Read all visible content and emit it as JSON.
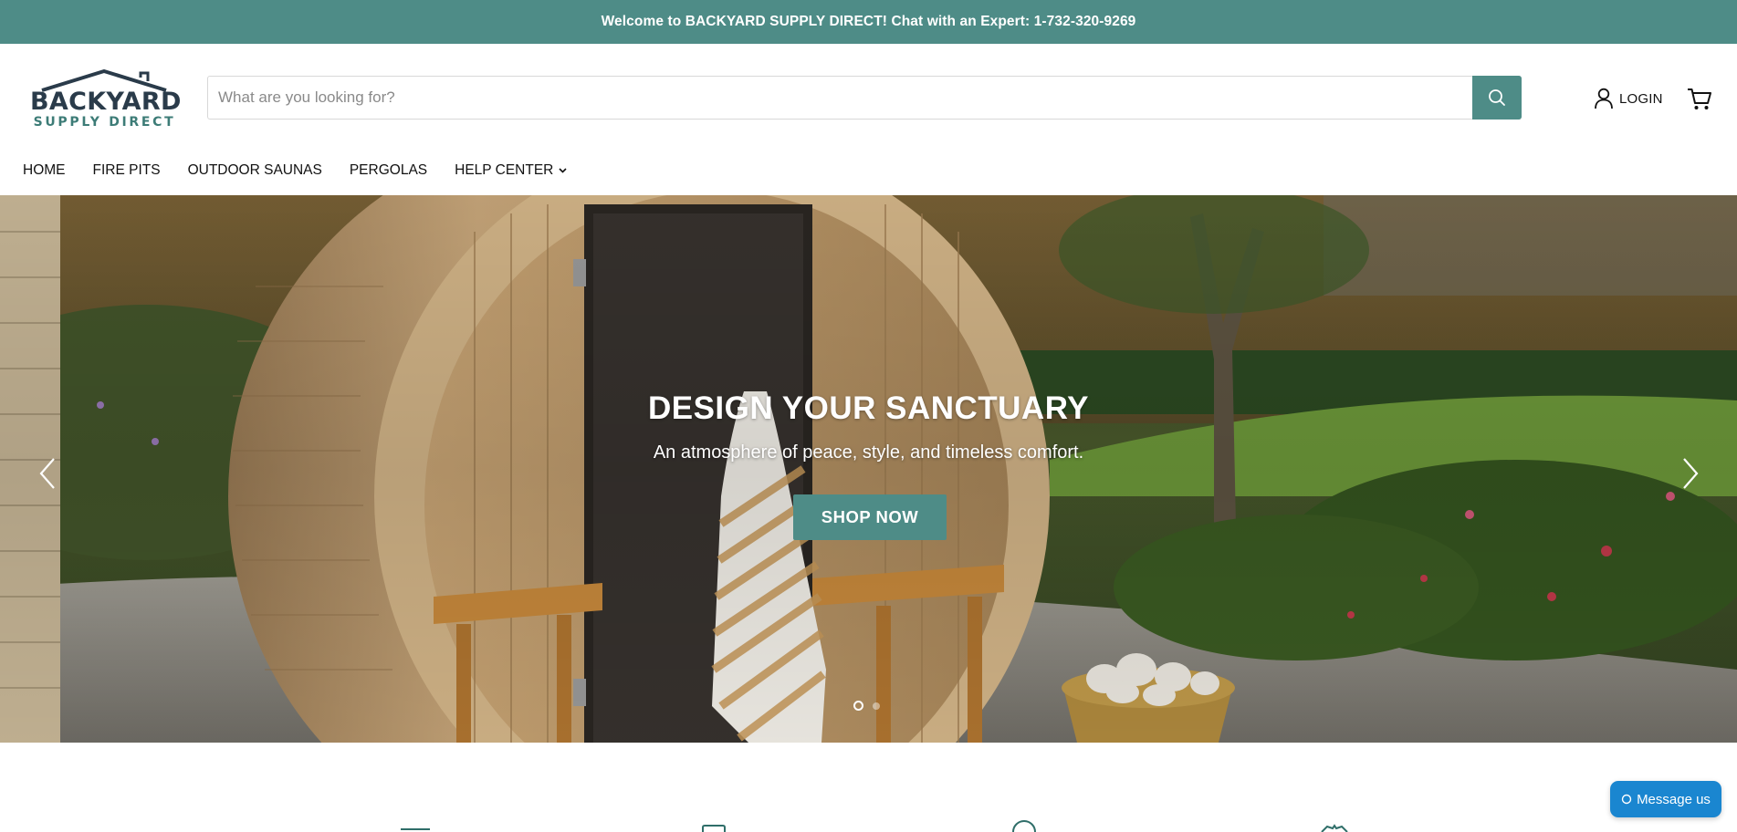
{
  "announcement": {
    "text": "Welcome to BACKYARD SUPPLY DIRECT! Chat with an Expert: 1-732-320-9269"
  },
  "brand": {
    "name": "BACKYARD",
    "tagline": "SUPPLY DIRECT"
  },
  "search": {
    "placeholder": "What are you looking for?",
    "value": "",
    "button_icon": "search-icon"
  },
  "account": {
    "login_label": "LOGIN",
    "login_icon": "user-icon",
    "cart_icon": "cart-icon"
  },
  "nav": {
    "items": [
      {
        "label": "HOME"
      },
      {
        "label": "FIRE PITS"
      },
      {
        "label": "OUTDOOR SAUNAS"
      },
      {
        "label": "PERGOLAS"
      },
      {
        "label": "HELP CENTER",
        "has_dropdown": true
      }
    ]
  },
  "hero": {
    "title": "DESIGN YOUR SANCTUARY",
    "subtitle": "An atmosphere of peace, style, and timeless comfort.",
    "cta_label": "SHOP NOW",
    "slides_total": 2,
    "active_slide": 1,
    "prev_icon": "chevron-left-icon",
    "next_icon": "chevron-right-icon"
  },
  "chat": {
    "label": "Message us"
  },
  "colors": {
    "accent": "#4e8c87",
    "chat": "#1a86d0",
    "brand_dark": "#2a3b4a"
  }
}
